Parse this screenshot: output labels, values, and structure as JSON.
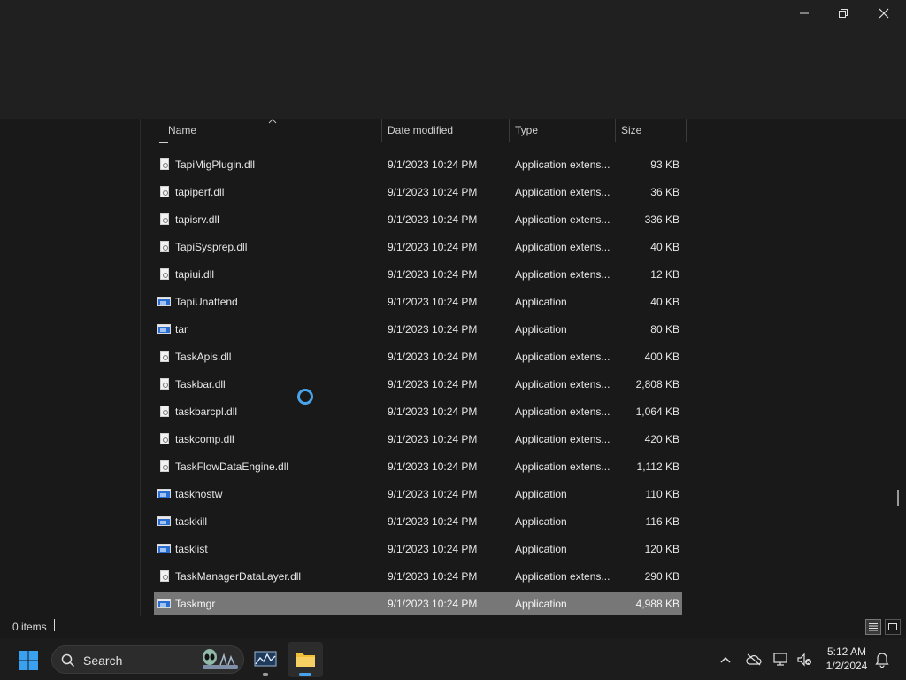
{
  "columns": {
    "name": "Name",
    "date_modified": "Date modified",
    "type": "Type",
    "size": "Size"
  },
  "files": [
    {
      "name": "TapiMigPlugin.dll",
      "date": "9/1/2023 10:24 PM",
      "type": "Application extens...",
      "size": "93 KB",
      "icon": "dll-file-icon"
    },
    {
      "name": "tapiperf.dll",
      "date": "9/1/2023 10:24 PM",
      "type": "Application extens...",
      "size": "36 KB",
      "icon": "dll-file-icon"
    },
    {
      "name": "tapisrv.dll",
      "date": "9/1/2023 10:24 PM",
      "type": "Application extens...",
      "size": "336 KB",
      "icon": "dll-file-icon"
    },
    {
      "name": "TapiSysprep.dll",
      "date": "9/1/2023 10:24 PM",
      "type": "Application extens...",
      "size": "40 KB",
      "icon": "dll-file-icon"
    },
    {
      "name": "tapiui.dll",
      "date": "9/1/2023 10:24 PM",
      "type": "Application extens...",
      "size": "12 KB",
      "icon": "dll-file-icon"
    },
    {
      "name": "TapiUnattend",
      "date": "9/1/2023 10:24 PM",
      "type": "Application",
      "size": "40 KB",
      "icon": "application-icon"
    },
    {
      "name": "tar",
      "date": "9/1/2023 10:24 PM",
      "type": "Application",
      "size": "80 KB",
      "icon": "application-icon"
    },
    {
      "name": "TaskApis.dll",
      "date": "9/1/2023 10:24 PM",
      "type": "Application extens...",
      "size": "400 KB",
      "icon": "dll-file-icon"
    },
    {
      "name": "Taskbar.dll",
      "date": "9/1/2023 10:24 PM",
      "type": "Application extens...",
      "size": "2,808 KB",
      "icon": "dll-file-icon"
    },
    {
      "name": "taskbarcpl.dll",
      "date": "9/1/2023 10:24 PM",
      "type": "Application extens...",
      "size": "1,064 KB",
      "icon": "dll-file-icon"
    },
    {
      "name": "taskcomp.dll",
      "date": "9/1/2023 10:24 PM",
      "type": "Application extens...",
      "size": "420 KB",
      "icon": "dll-file-icon"
    },
    {
      "name": "TaskFlowDataEngine.dll",
      "date": "9/1/2023 10:24 PM",
      "type": "Application extens...",
      "size": "1,112 KB",
      "icon": "dll-file-icon"
    },
    {
      "name": "taskhostw",
      "date": "9/1/2023 10:24 PM",
      "type": "Application",
      "size": "110 KB",
      "icon": "application-icon"
    },
    {
      "name": "taskkill",
      "date": "9/1/2023 10:24 PM",
      "type": "Application",
      "size": "116 KB",
      "icon": "application-icon"
    },
    {
      "name": "tasklist",
      "date": "9/1/2023 10:24 PM",
      "type": "Application",
      "size": "120 KB",
      "icon": "application-icon"
    },
    {
      "name": "TaskManagerDataLayer.dll",
      "date": "9/1/2023 10:24 PM",
      "type": "Application extens...",
      "size": "290 KB",
      "icon": "dll-file-icon"
    },
    {
      "name": "Taskmgr",
      "date": "9/1/2023 10:24 PM",
      "type": "Application",
      "size": "4,988 KB",
      "icon": "application-icon",
      "selected": true
    }
  ],
  "status": {
    "items_count": "0 items"
  },
  "taskbar": {
    "search_label": "Search"
  },
  "clock": {
    "time": "5:12 AM",
    "date": "1/2/2024"
  },
  "colors": {
    "accent": "#4aa3e8",
    "selection": "#777777",
    "background": "#191919"
  }
}
